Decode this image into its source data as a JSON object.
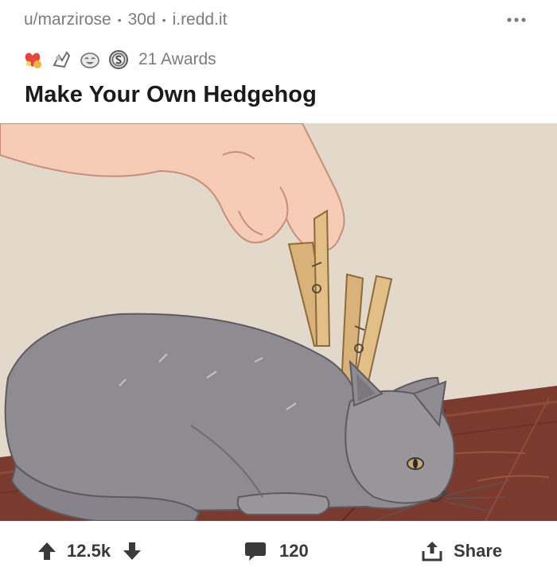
{
  "post": {
    "author": "u/marzirose",
    "age": "30d",
    "domain": "i.redd.it",
    "separator": "•",
    "awards_label": "21 Awards",
    "title": "Make Your Own Hedgehog"
  },
  "awards": [
    {
      "icon": "wholesome-heart-award-icon",
      "color": "#e8453c"
    },
    {
      "icon": "tearing-up-award-icon",
      "color": "#8a8a8a"
    },
    {
      "icon": "laughing-face-award-icon",
      "color": "#8a8a8a"
    },
    {
      "icon": "silver-coin-award-icon",
      "color": "#6e6e6e"
    }
  ],
  "image": {
    "alt": "Illustration of a hand clipping wooden clothespins onto a grey cat lying on a wooden floor"
  },
  "actions": {
    "upvote_count": "12.5k",
    "comments_count": "120",
    "share_label": "Share"
  },
  "colors": {
    "meta_text": "#7c7c7c",
    "title_text": "#1a1a1b",
    "action_icon": "#3a3a3c",
    "wall": "#e6ded0",
    "floor": "#7a3b2e",
    "cat": "#8e8c91",
    "clothespin": "#d9b27a",
    "skin": "#f6ccb6"
  }
}
